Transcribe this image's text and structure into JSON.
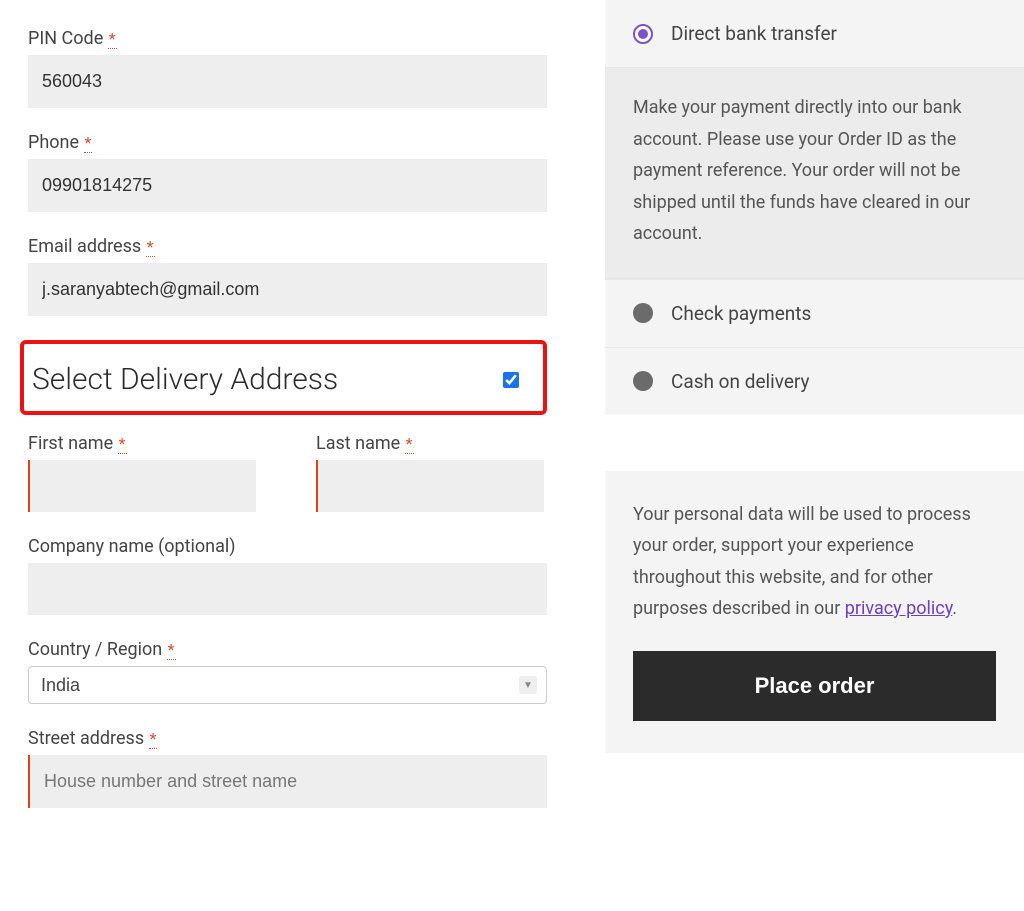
{
  "billing": {
    "pin_label": "PIN Code",
    "pin_value": "560043",
    "phone_label": "Phone",
    "phone_value": "09901814275",
    "email_label": "Email address",
    "email_value": "j.saranyabtech@gmail.com"
  },
  "delivery": {
    "section_title": "Select Delivery Address",
    "checkbox_checked": true,
    "first_name_label": "First name",
    "first_name_value": "",
    "last_name_label": "Last name",
    "last_name_value": "",
    "company_label": "Company name (optional)",
    "company_value": "",
    "country_label": "Country / Region",
    "country_value": "India",
    "street_label": "Street address",
    "street_placeholder": "House number and street name",
    "street_value": ""
  },
  "required_marker": "*",
  "payment": {
    "options": [
      {
        "label": "Direct bank transfer",
        "selected": true
      },
      {
        "label": "Check payments",
        "selected": false
      },
      {
        "label": "Cash on delivery",
        "selected": false
      }
    ],
    "bank_desc": "Make your payment directly into our bank account. Please use your Order ID as the payment reference. Your order will not be shipped until the funds have cleared in our account."
  },
  "privacy": {
    "text_prefix": "Your personal data will be used to process your order, support your experience throughout this website, and for other purposes described in our ",
    "link_text": "privacy policy",
    "text_suffix": "."
  },
  "place_order_label": "Place order"
}
